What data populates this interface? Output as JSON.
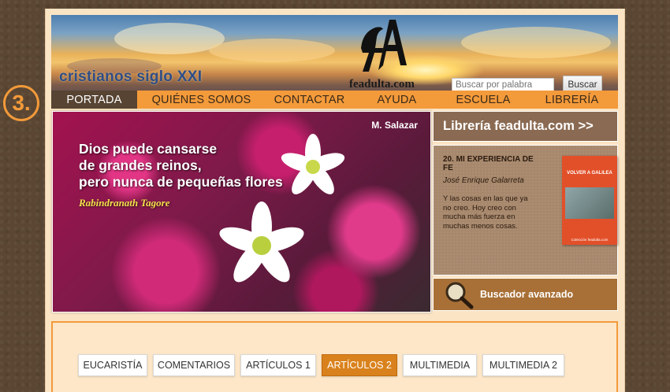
{
  "step_badge": "3.",
  "header": {
    "tagline": "cristianos siglo XXI",
    "logo_letter": "fA",
    "logo_text": "feadulta.com"
  },
  "search": {
    "placeholder": "Buscar por palabra",
    "button_label": "Buscar"
  },
  "nav": {
    "items": [
      {
        "label": "PORTADA",
        "active": true
      },
      {
        "label": "QUIÉNES SOMOS"
      },
      {
        "label": "CONTACTAR"
      },
      {
        "label": "AYUDA"
      },
      {
        "label": "ESCUELA"
      },
      {
        "label": "LIBRERÍA"
      }
    ]
  },
  "hero": {
    "author": "M. Salazar",
    "quote": "Dios puede cansarse\nde grandes reinos,\npero nunca de pequeñas flores",
    "attribution": "Rabindranath Tagore"
  },
  "sidebar": {
    "library_banner": "Librería feadulta.com >>",
    "book": {
      "title": "20. MI EXPERIENCIA DE FE",
      "author": "José Enrique Galarreta",
      "blurb": "Y las cosas en las que ya no creo. Hoy creo con mucha más fuerza en muchas menos cosas.",
      "cover_title": "VOLVER A GALILEA",
      "cover_footer": "Colección feadulta.com"
    },
    "advanced_search": "Buscador avanzado"
  },
  "tabs": [
    {
      "label": "EUCARISTÍA"
    },
    {
      "label": "COMENTARIOS"
    },
    {
      "label": "ARTÍCULOS 1"
    },
    {
      "label": "ARTÍCULOS 2",
      "active": true
    },
    {
      "label": "MULTIMEDIA"
    },
    {
      "label": "MULTIMEDIA 2"
    }
  ],
  "colors": {
    "nav_bar": "#f39a3a",
    "nav_active": "#574432",
    "tab_active": "#d9821d",
    "tagline": "#2e4d86"
  }
}
